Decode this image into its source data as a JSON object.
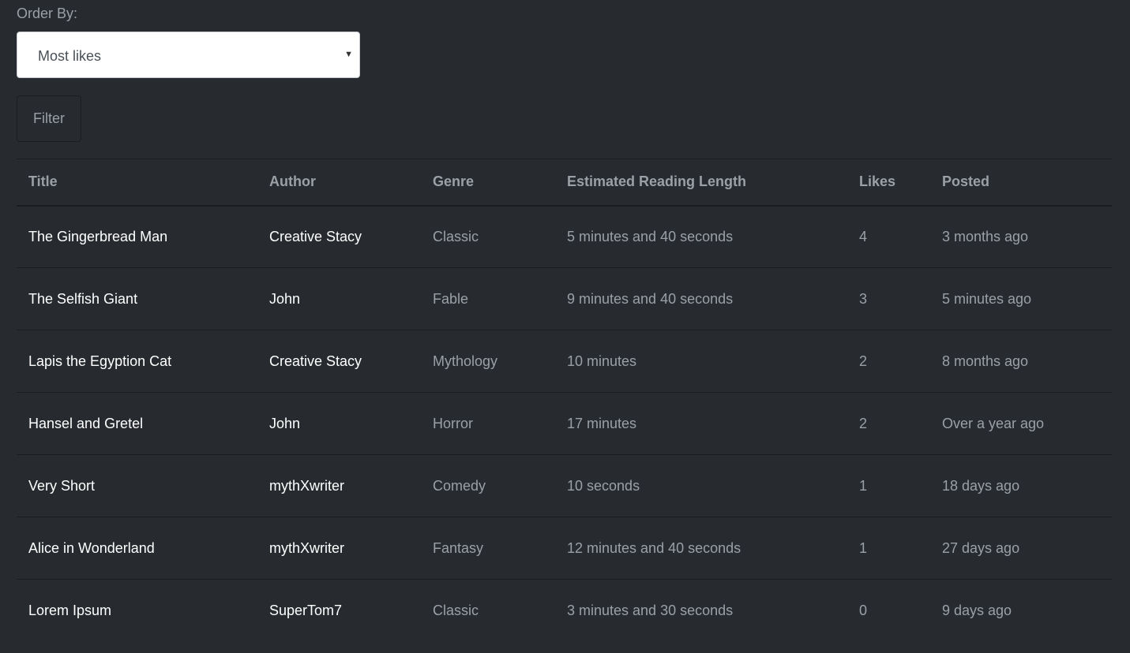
{
  "filter_form": {
    "order_label": "Order By:",
    "order_selected": "Most likes",
    "filter_button": "Filter"
  },
  "table": {
    "headers": {
      "title": "Title",
      "author": "Author",
      "genre": "Genre",
      "length": "Estimated Reading Length",
      "likes": "Likes",
      "posted": "Posted"
    },
    "rows": [
      {
        "title": "The Gingerbread Man",
        "author": "Creative Stacy",
        "genre": "Classic",
        "length": "5 minutes and 40 seconds",
        "likes": "4",
        "posted": "3 months ago"
      },
      {
        "title": "The Selfish Giant",
        "author": "John",
        "genre": "Fable",
        "length": "9 minutes and 40 seconds",
        "likes": "3",
        "posted": "5 minutes ago"
      },
      {
        "title": "Lapis the Egyption Cat",
        "author": "Creative Stacy",
        "genre": "Mythology",
        "length": "10 minutes",
        "likes": "2",
        "posted": "8 months ago"
      },
      {
        "title": "Hansel and Gretel",
        "author": "John",
        "genre": "Horror",
        "length": "17 minutes",
        "likes": "2",
        "posted": "Over a year ago"
      },
      {
        "title": "Very Short",
        "author": "mythXwriter",
        "genre": "Comedy",
        "length": "10 seconds",
        "likes": "1",
        "posted": "18 days ago"
      },
      {
        "title": "Alice in Wonderland",
        "author": "mythXwriter",
        "genre": "Fantasy",
        "length": "12 minutes and 40 seconds",
        "likes": "1",
        "posted": "27 days ago"
      },
      {
        "title": "Lorem Ipsum",
        "author": "SuperTom7",
        "genre": "Classic",
        "length": "3 minutes and 30 seconds",
        "likes": "0",
        "posted": "9 days ago"
      }
    ]
  },
  "icons": {
    "select_caret": "chevron-down-icon"
  },
  "colors": {
    "background": "#272b30",
    "bright_text": "#ffffff",
    "muted_text": "#9aa0a6",
    "border": "#1b1e21"
  }
}
